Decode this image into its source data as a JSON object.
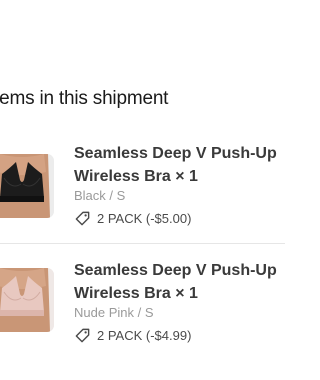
{
  "shipment": {
    "title": "tems in this shipment",
    "items": [
      {
        "name_line1": "Seamless Deep V Push-Up",
        "name_line2": "Wireless Bra × 1",
        "variant": "Black / S",
        "promo": "2 PACK (-$5.00)",
        "thumbnail": "black-bra-photo"
      },
      {
        "name_line1": "Seamless Deep V Push-Up",
        "name_line2": "Wireless Bra × 1",
        "variant": "Nude Pink / S",
        "promo": "2 PACK (-$4.99)",
        "thumbnail": "nude-pink-bra-photo"
      }
    ]
  },
  "icons": {
    "promo": "tag-icon"
  },
  "colors": {
    "title": "#1a1a1a",
    "product_name": "#3a3a3a",
    "variant": "#9a9a9a",
    "divider": "#e6e6e6",
    "bra_black": "#1c1c1c",
    "bra_nude": "#e8c8c0"
  }
}
